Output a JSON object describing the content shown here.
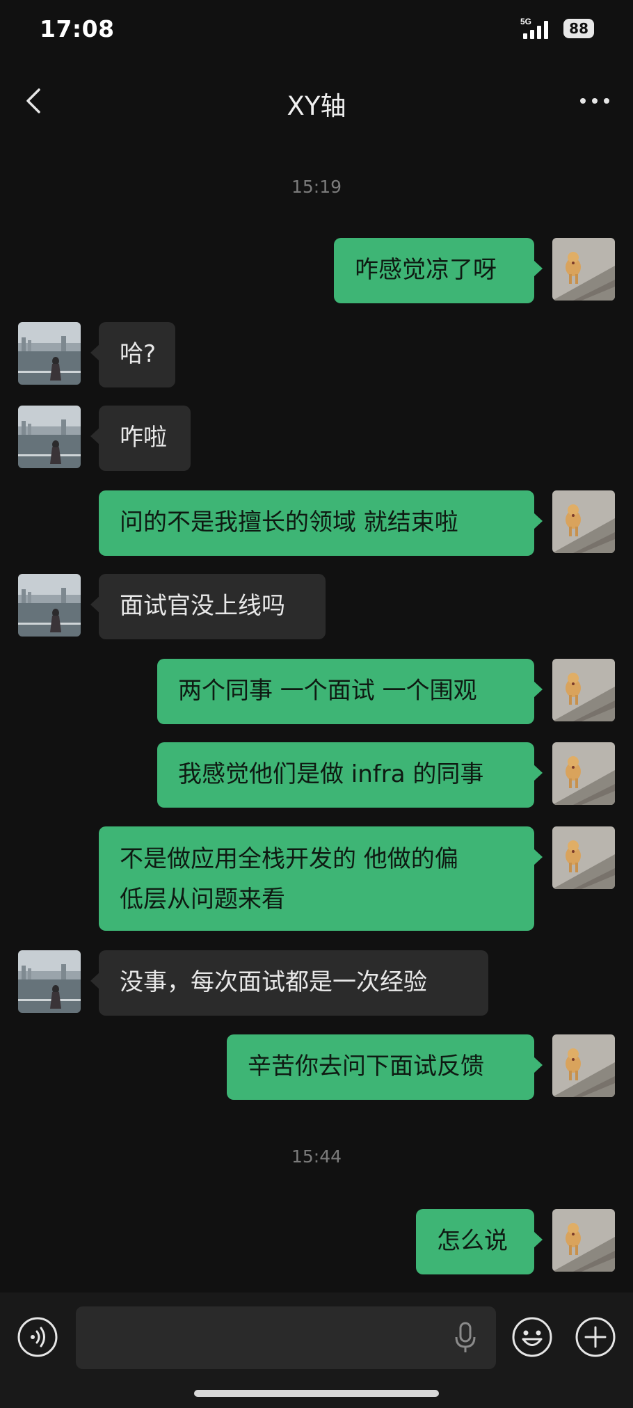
{
  "status": {
    "time": "17:08",
    "network": "5G",
    "battery": "88"
  },
  "nav": {
    "title": "XY轴"
  },
  "timestamps": [
    "15:19",
    "15:44"
  ],
  "messages": [
    {
      "dir": "out",
      "lines": [
        "咋感觉凉了呀"
      ]
    },
    {
      "dir": "in",
      "lines": [
        "哈?"
      ]
    },
    {
      "dir": "in",
      "lines": [
        "咋啦"
      ]
    },
    {
      "dir": "out",
      "lines": [
        "问的不是我擅长的领域 就结束啦"
      ]
    },
    {
      "dir": "in",
      "lines": [
        "面试官没上线吗"
      ]
    },
    {
      "dir": "out",
      "lines": [
        "两个同事 一个面试 一个围观"
      ]
    },
    {
      "dir": "out",
      "lines": [
        "我感觉他们是做 infra 的同事"
      ]
    },
    {
      "dir": "out",
      "lines": [
        "不是做应用全栈开发的 他做的偏",
        "低层从问题来看"
      ]
    },
    {
      "dir": "in",
      "lines": [
        "没事，每次面试都是一次经验"
      ]
    },
    {
      "dir": "out",
      "lines": [
        "辛苦你去问下面试反馈"
      ]
    },
    {
      "dir": "out",
      "lines": [
        "怎么说"
      ]
    }
  ],
  "input": {
    "placeholder": ""
  },
  "colors": {
    "accent": "#3eb575",
    "incoming": "#2b2b2b",
    "background": "#111111"
  },
  "icons": {
    "back": "chevron-left-icon",
    "more": "more-icon",
    "voice": "voice-input-icon",
    "mic": "mic-icon",
    "emoji": "emoji-icon",
    "plus": "plus-icon"
  }
}
